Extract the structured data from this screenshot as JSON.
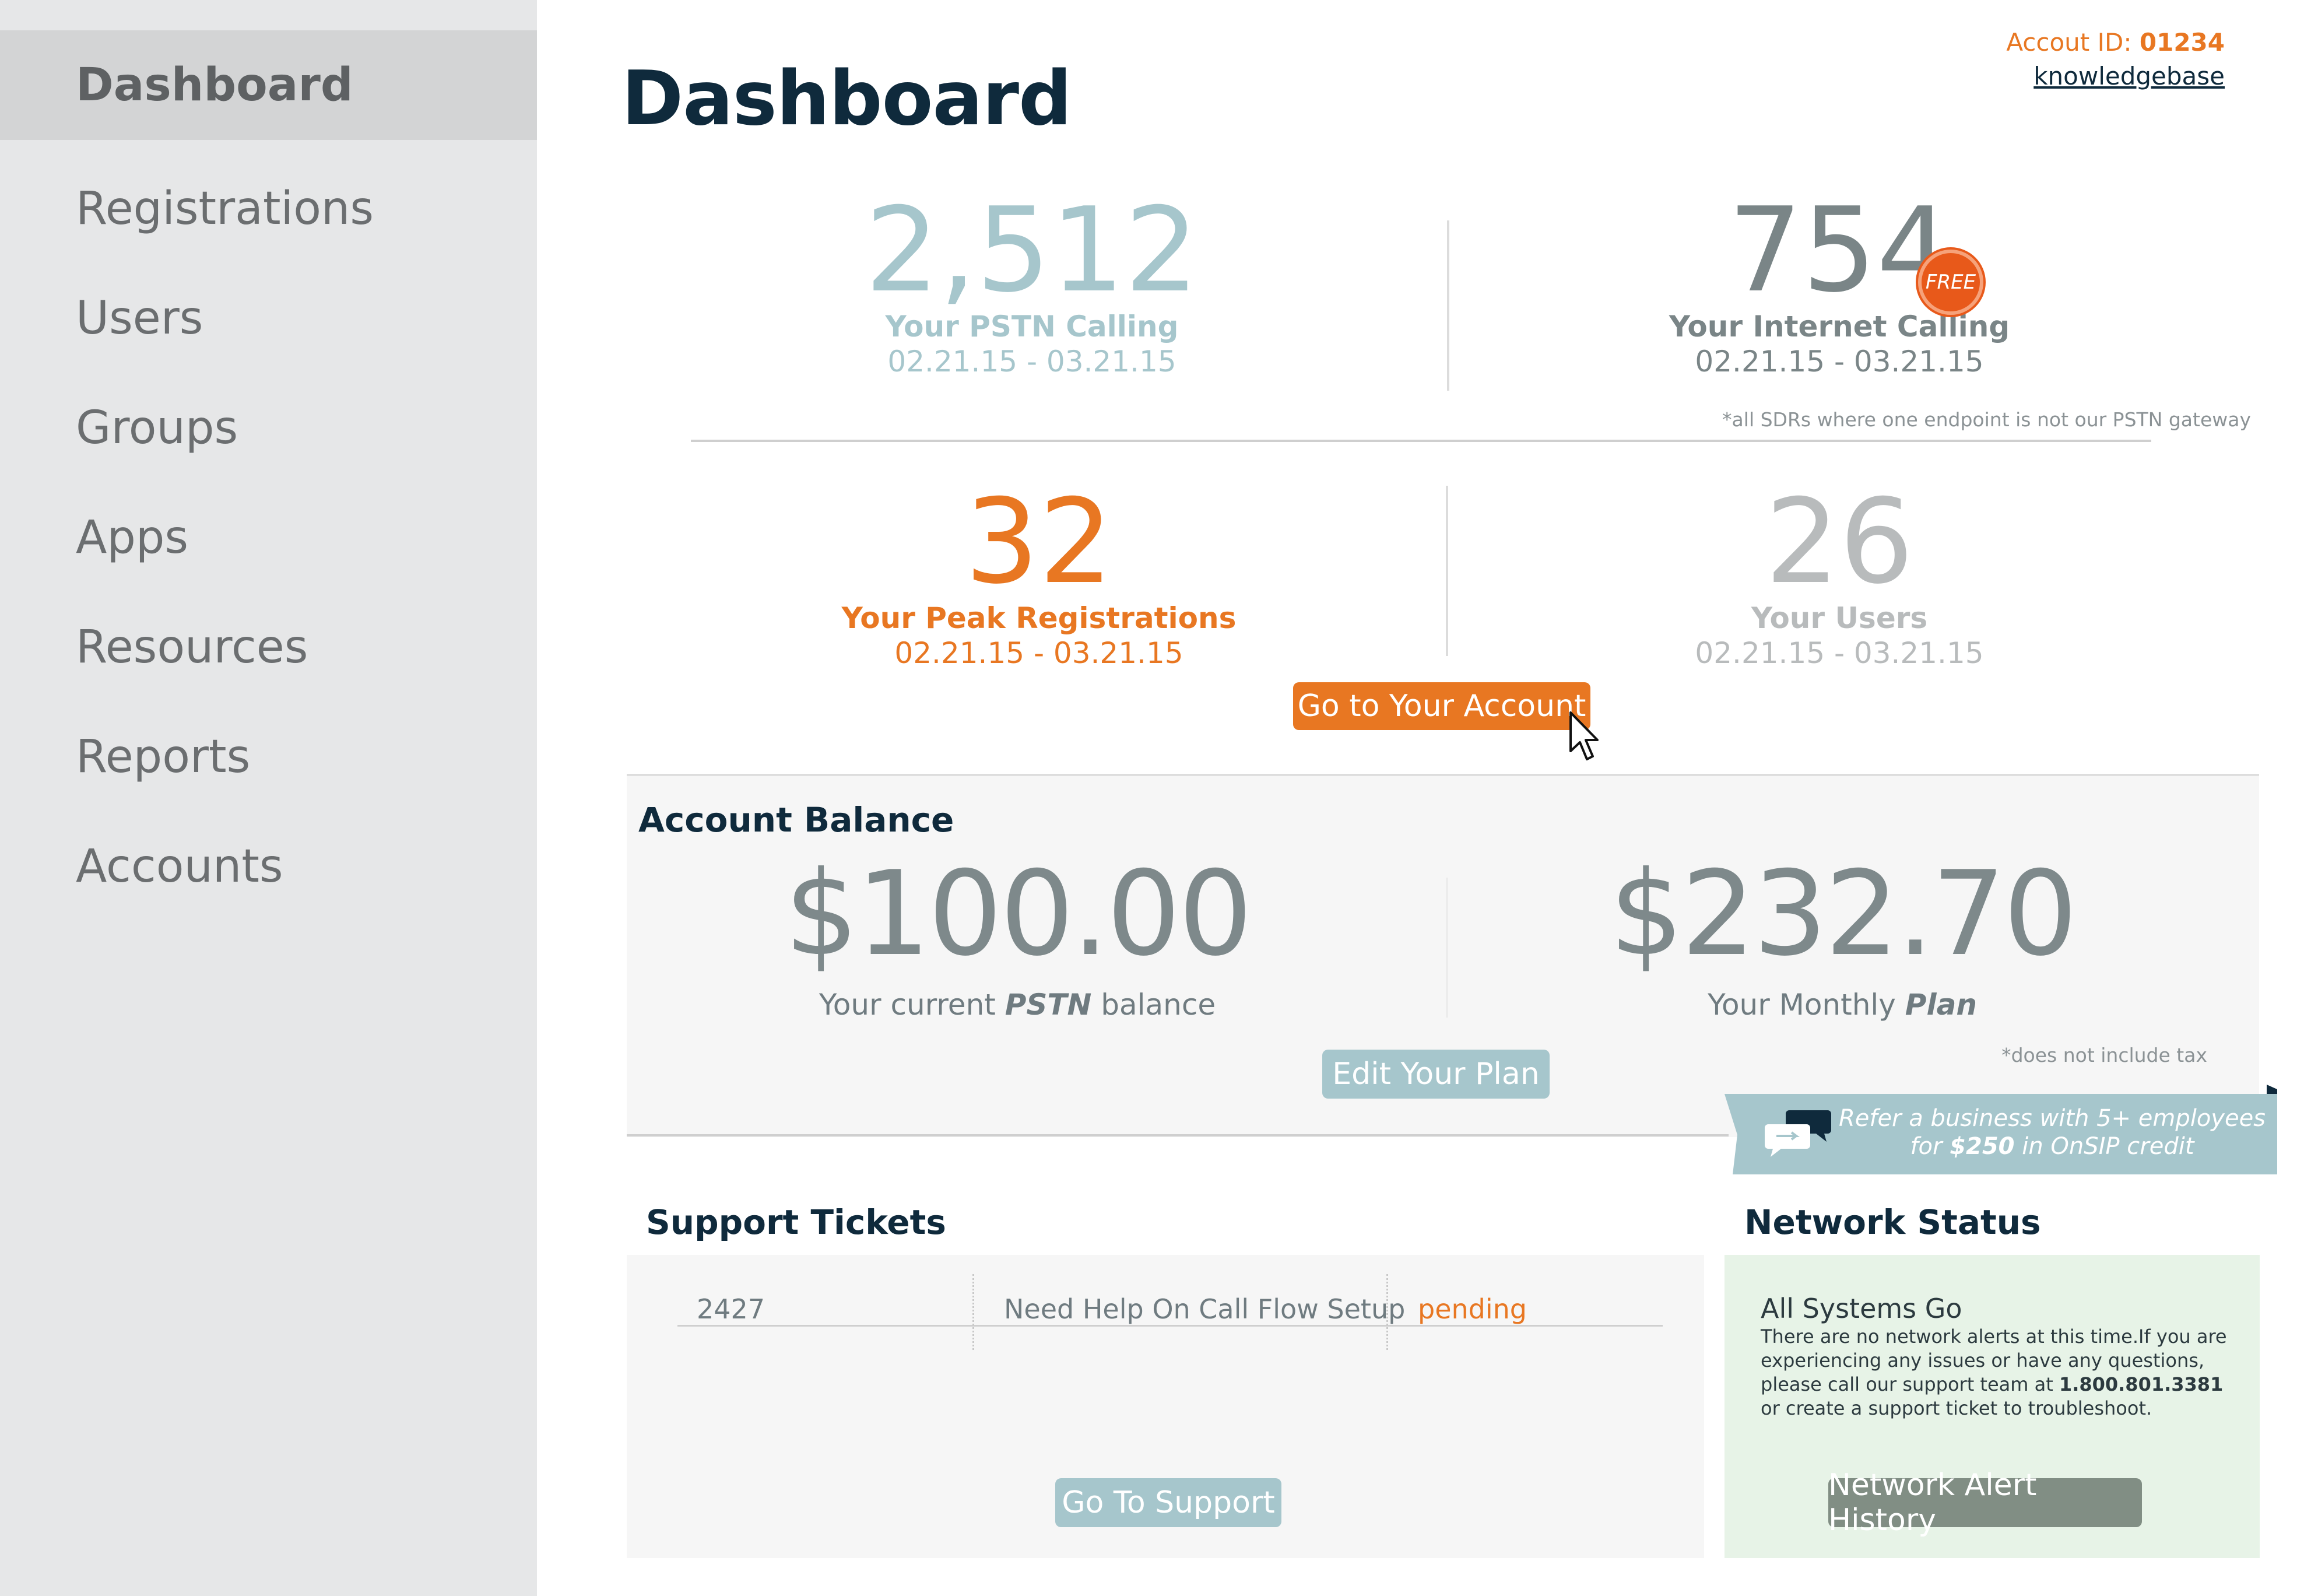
{
  "sidebar": {
    "items": [
      {
        "label": "Dashboard",
        "active": true
      },
      {
        "label": "Registrations"
      },
      {
        "label": "Users"
      },
      {
        "label": "Groups"
      },
      {
        "label": "Apps"
      },
      {
        "label": "Resources"
      },
      {
        "label": "Reports"
      },
      {
        "label": "Accounts"
      }
    ]
  },
  "header": {
    "title": "Dashboard",
    "account_id_label": "Accout ID:",
    "account_id_value": "01234",
    "knowledgebase_link": "knowledgebase"
  },
  "stats": {
    "pstn": {
      "value": "2,512",
      "label": "Your PSTN Calling",
      "dates": "02.21.15 - 03.21.15"
    },
    "internet": {
      "value": "754",
      "badge": "FREE",
      "label": "Your Internet Calling",
      "dates": "02.21.15 - 03.21.15"
    },
    "internet_note": "*all SDRs where one endpoint is not our PSTN gateway",
    "peak": {
      "value": "32",
      "label": "Your Peak Registrations",
      "dates": "02.21.15 - 03.21.15"
    },
    "users": {
      "value": "26",
      "label": "Your Users",
      "dates": "02.21.15 - 03.21.15"
    },
    "account_button": "Go to Your Account"
  },
  "balance": {
    "title": "Account Balance",
    "pstn_amount": "$100.00",
    "pstn_label_pre": "Your current ",
    "pstn_label_em": "PSTN",
    "pstn_label_post": " balance",
    "plan_amount": "$232.70",
    "plan_label_pre": "Your Monthly ",
    "plan_label_em": "Plan",
    "edit_button": "Edit Your Plan",
    "tax_note": "*does not include tax"
  },
  "refer": {
    "line1": "Refer a business with 5+ employees",
    "line2_pre": "for ",
    "line2_amount": "$250",
    "line2_post": " in OnSIP credit"
  },
  "tickets": {
    "title": "Support Tickets",
    "rows": [
      {
        "id": "2427",
        "subject": "Need Help On Call Flow Setup",
        "status": "pending"
      }
    ],
    "button": "Go To Support"
  },
  "network": {
    "title": "Network Status",
    "heading": "All Systems Go",
    "message_pre": "There are no network alerts at this time.If you are experiencing any issues or have any questions, please call our support team at ",
    "phone": "1.800.801.3381",
    "message_post": " or create a support ticket to troubleshoot.",
    "button": "Network Alert History"
  },
  "colors": {
    "accent_orange": "#e87722",
    "navy": "#0f2a3c",
    "teal_button": "#a6c6cc",
    "status_green_bg": "#e7f3e7"
  }
}
